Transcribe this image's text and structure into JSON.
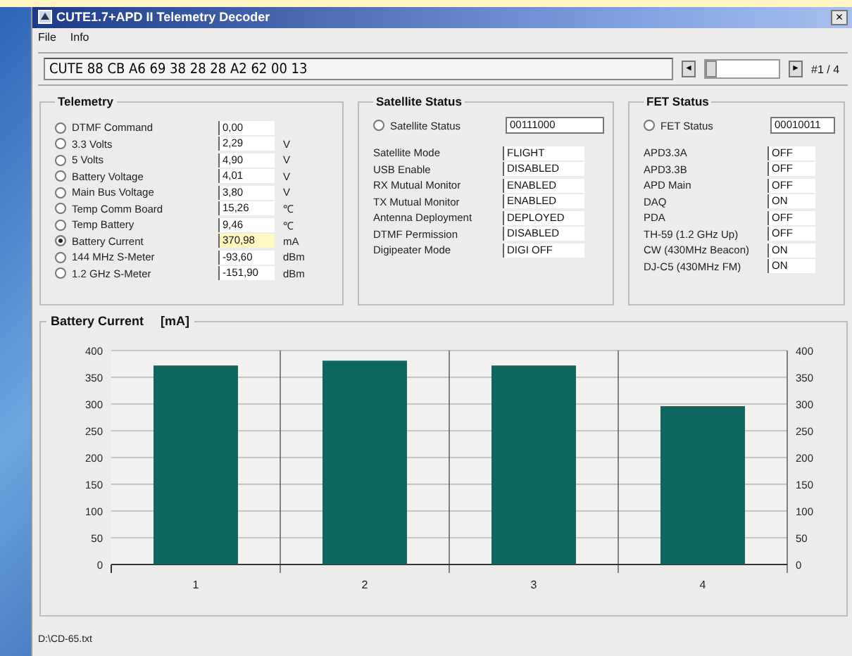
{
  "window": {
    "title": "CUTE1.7+APD II Telemetry Decoder",
    "close": "×"
  },
  "menu": [
    "File",
    "Info"
  ],
  "record": {
    "text": "CUTE 88 CB A6 69 38 28 28 A2 62 00 13",
    "prev": "◄",
    "next": "►",
    "counter": "#1 / 4"
  },
  "telemetry": {
    "title": "Telemetry",
    "items": [
      {
        "label": "DTMF Command",
        "value": "0,00",
        "selected": false
      },
      {
        "label": "3.3 Volts",
        "value": "2,29",
        "unit": "V",
        "selected": false
      },
      {
        "label": "5 Volts",
        "value": "4,90",
        "unit": "V",
        "selected": false
      },
      {
        "label": "Battery Voltage",
        "value": "4,01",
        "unit": "V",
        "selected": false
      },
      {
        "label": "Main Bus Voltage",
        "value": "3,80",
        "unit": "V",
        "selected": false
      },
      {
        "label": "Temp Comm Board",
        "value": "15,26",
        "unit": "℃",
        "selected": false
      },
      {
        "label": "Temp Battery",
        "value": "9,46",
        "unit": "℃",
        "selected": false
      },
      {
        "label": "Battery Current",
        "value": "370,98",
        "unit": "mA",
        "selected": true
      },
      {
        "label": "144 MHz S-Meter",
        "value": "-93,60",
        "unit": "dBm",
        "selected": false
      },
      {
        "label": "1.2 GHz S-Meter",
        "value": "-151,90",
        "unit": "dBm",
        "selected": false
      }
    ]
  },
  "satellite_status": {
    "title": "Satellite Status",
    "header": {
      "label": "Satellite Status",
      "value": "00111000",
      "selected": false
    },
    "items": [
      {
        "label": "Satellite Mode",
        "value": "FLIGHT"
      },
      {
        "label": "USB Enable",
        "value": "DISABLED"
      },
      {
        "label": "RX Mutual Monitor",
        "value": "ENABLED"
      },
      {
        "label": "TX Mutual Monitor",
        "value": "ENABLED"
      },
      {
        "label": "Antenna Deployment",
        "value": "DEPLOYED"
      },
      {
        "label": "DTMF Permission",
        "value": "DISABLED"
      },
      {
        "label": "Digipeater Mode",
        "value": "DIGI OFF"
      }
    ]
  },
  "fet_status": {
    "title": "FET Status",
    "header": {
      "label": "FET Status",
      "value": "00010011",
      "selected": false
    },
    "items": [
      {
        "label": "APD3.3A",
        "value": "OFF"
      },
      {
        "label": "APD3.3B",
        "value": "OFF"
      },
      {
        "label": "APD Main",
        "value": "OFF"
      },
      {
        "label": "DAQ",
        "value": "ON"
      },
      {
        "label": "PDA",
        "value": "OFF"
      },
      {
        "label": "TH-59 (1.2 GHz Up)",
        "value": "OFF"
      },
      {
        "label": "CW (430MHz Beacon)",
        "value": "ON"
      },
      {
        "label": "DJ-C5 (430MHz FM)",
        "value": "ON"
      }
    ]
  },
  "chart": {
    "title": "Battery Current",
    "unit": "[mA]",
    "chart_data": {
      "type": "bar",
      "categories": [
        "1",
        "2",
        "3",
        "4"
      ],
      "series": [
        {
          "color": "#0e6660",
          "values": [
            372,
            381,
            372,
            296
          ]
        }
      ],
      "ylim": [
        0,
        400
      ],
      "yticks": [
        0,
        50,
        100,
        150,
        200,
        250,
        300,
        350,
        400
      ],
      "grid": true
    },
    "right_axis_ticks": [
      "400",
      "350",
      "300",
      "250",
      "200",
      "150",
      "100",
      "50",
      "0"
    ]
  },
  "status_bar": "D:\\CD-65.txt"
}
